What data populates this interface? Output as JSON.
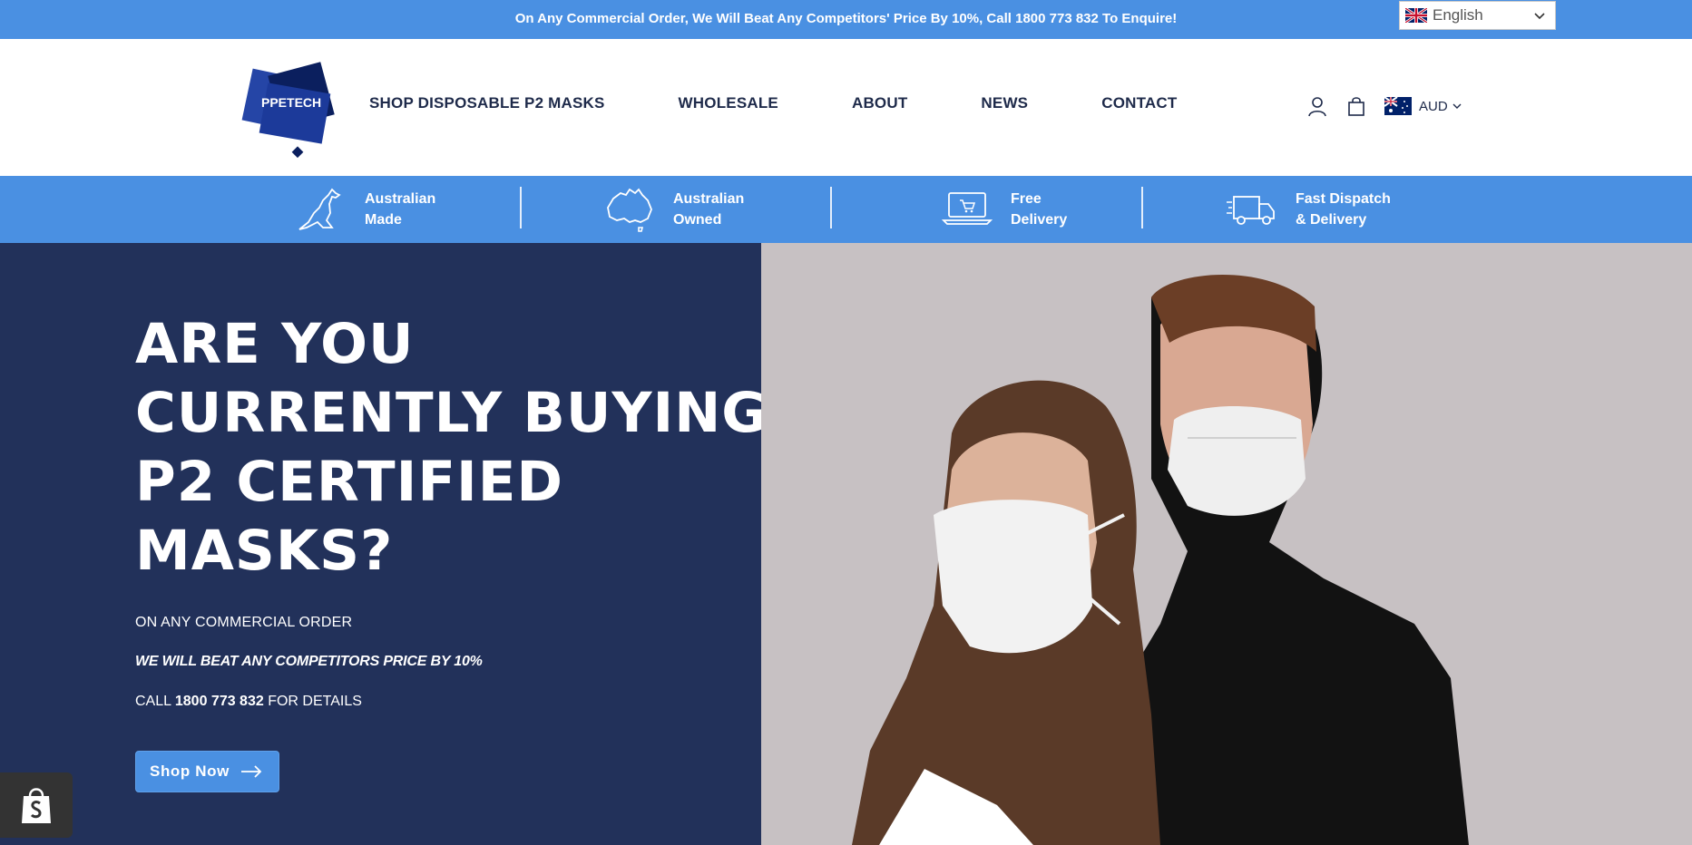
{
  "announcement": {
    "text": "On Any Commercial Order, We Will Beat Any Competitors' Price By 10%, Call 1800 773 832 To Enquire!"
  },
  "language": {
    "selected": "English",
    "flag_icon": "uk-flag-icon"
  },
  "logo": {
    "text": "PPETECH"
  },
  "nav": {
    "items": [
      "SHOP DISPOSABLE P2 MASKS",
      "WHOLESALE",
      "ABOUT",
      "NEWS",
      "CONTACT"
    ]
  },
  "header_icons": {
    "account_icon": "user-icon",
    "cart_icon": "shopping-bag-icon"
  },
  "currency": {
    "code": "AUD",
    "flag_icon": "australia-flag-icon"
  },
  "features": [
    {
      "icon": "kangaroo-icon",
      "line1": "Australian",
      "line2": "Made"
    },
    {
      "icon": "australia-map-icon",
      "line1": "Australian",
      "line2": "Owned"
    },
    {
      "icon": "laptop-cart-icon",
      "line1": "Free",
      "line2": "Delivery"
    },
    {
      "icon": "delivery-truck-icon",
      "line1": "Fast Dispatch",
      "line2": "& Delivery"
    }
  ],
  "hero": {
    "headline": [
      "ARE YOU",
      "CURRENTLY BUYING",
      "P2 CERTIFIED",
      "MASKS?"
    ],
    "sub1": "ON ANY COMMERCIAL ORDER",
    "sub2": "WE WILL BEAT ANY COMPETITORS PRICE BY 10%",
    "sub3_prefix": "CALL ",
    "sub3_phone": "1800 773 832",
    "sub3_suffix": " FOR DETAILS",
    "button_label": "Shop Now",
    "image_icon": "people-wearing-masks-photo"
  },
  "colors": {
    "accent": "#4a90e2",
    "hero_dark": "#22315a",
    "text_dark": "#1e2a4a"
  }
}
